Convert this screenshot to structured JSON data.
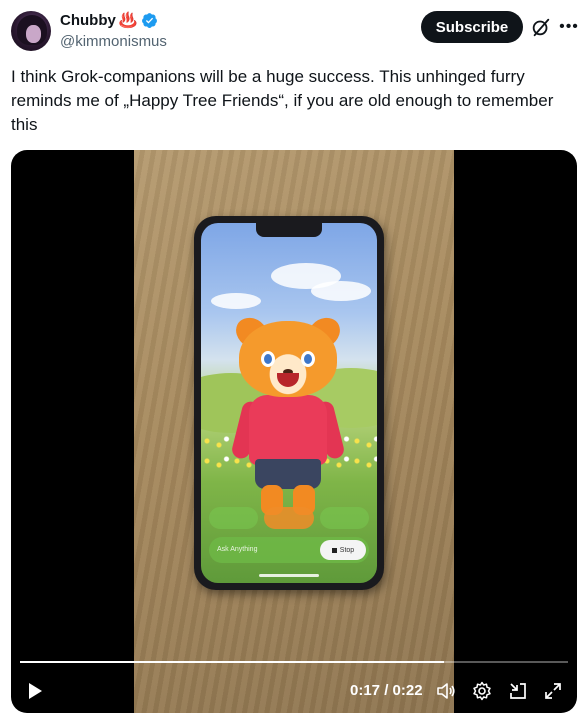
{
  "author": {
    "name": "Chubby",
    "name_emoji": "♨️",
    "handle": "@kimmonismus",
    "verified": true
  },
  "actions": {
    "subscribe_label": "Subscribe",
    "grok_icon": "grok-icon",
    "more_icon": "more-icon"
  },
  "tweet": {
    "text": "I think Grok-companions will be a huge success. This unhinged furry reminds me of „Happy Tree Friends“, if you are old enough to remember this"
  },
  "video": {
    "in_video": {
      "ask_placeholder": "Ask Anything",
      "stop_label": "Stop"
    },
    "player": {
      "timecode": "0:17 / 0:22",
      "progress": 0.773,
      "icons": [
        "play-icon",
        "volume-icon",
        "settings-icon",
        "minimize-icon",
        "fullscreen-icon"
      ]
    }
  },
  "colors": {
    "subscribe_bg": "#0f1419",
    "verified": "#1d9bf0",
    "handle": "#536471"
  }
}
